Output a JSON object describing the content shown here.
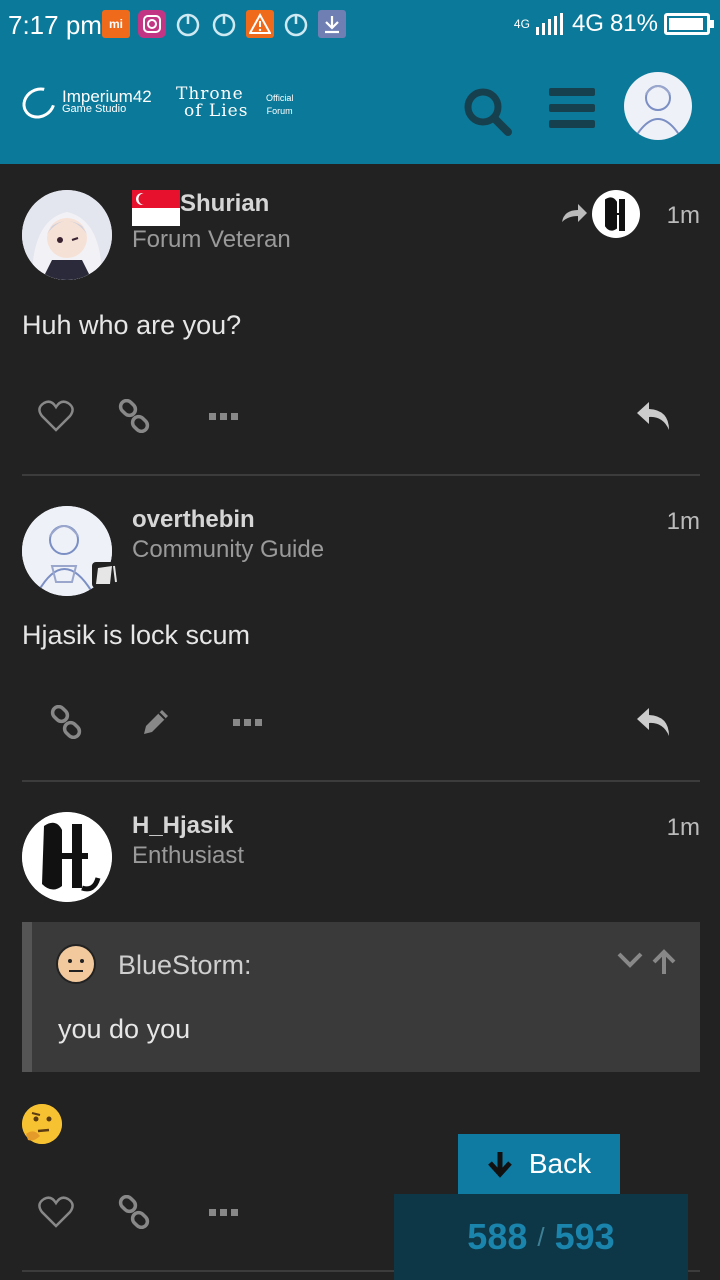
{
  "status_bar": {
    "time": "7:17 pm",
    "network_small": "4G",
    "network": "4G",
    "battery": "81%"
  },
  "header": {
    "studio_name": "Imperium42",
    "studio_sub": "Game Studio",
    "game_line1": "Throne",
    "game_line2": "of Lies",
    "official_line1": "Official",
    "official_line2": "Forum"
  },
  "posts": [
    {
      "username": "Shurian",
      "title": "Forum Veteran",
      "time": "1m",
      "body": "Huh who are you?"
    },
    {
      "username": "overthebin",
      "title": "Community Guide",
      "time": "1m",
      "body": "Hjasik is lock scum"
    },
    {
      "username": "H_Hjasik",
      "title": "Enthusiast",
      "time": "1m",
      "quote_author": "BlueStorm:",
      "quote_body": "you do you"
    }
  ],
  "controls": {
    "back_label": "Back",
    "progress_current": "588",
    "progress_sep": "/",
    "progress_total": "593"
  },
  "colors": {
    "header_teal": "#0b7a9a",
    "accent_blue": "#1a84ad",
    "background": "#222222"
  }
}
